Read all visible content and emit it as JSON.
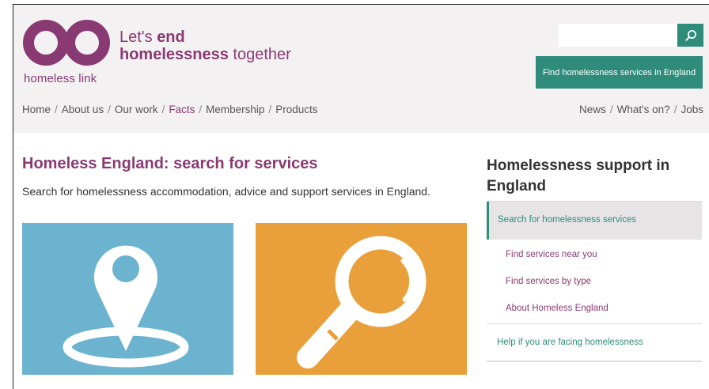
{
  "brand": {
    "logo_text": "homeless link",
    "tagline_line1_prefix": "Let's ",
    "tagline_line1_bold": "end",
    "tagline_line2_bold": "homelessness",
    "tagline_line2_suffix": " together",
    "color": "#8a3a73"
  },
  "header": {
    "search_placeholder": "",
    "search_icon": "search-icon",
    "find_button_label": "Find homelessness services in England",
    "accent_color": "#2f8c7a"
  },
  "nav": {
    "left": [
      {
        "label": "Home"
      },
      {
        "label": "About us"
      },
      {
        "label": "Our work"
      },
      {
        "label": "Facts",
        "active": true
      },
      {
        "label": "Membership"
      },
      {
        "label": "Products"
      }
    ],
    "right": [
      {
        "label": "News"
      },
      {
        "label": "What's on?"
      },
      {
        "label": "Jobs"
      }
    ],
    "separator": "/"
  },
  "main": {
    "title": "Homeless England: search for services",
    "description": "Search for homelessness accommodation, advice and support services in England.",
    "tiles": [
      {
        "icon": "map-pin-icon",
        "color": "#6bb3cf"
      },
      {
        "icon": "magnifier-icon",
        "color": "#eaa03a"
      }
    ]
  },
  "sidebar": {
    "title": "Homelessness support in England",
    "active_item": "Search for homelessness services",
    "sub_items": [
      "Find services near you",
      "Find services by type",
      "About Homeless England"
    ],
    "help_item": "Help if you are facing homelessness"
  }
}
